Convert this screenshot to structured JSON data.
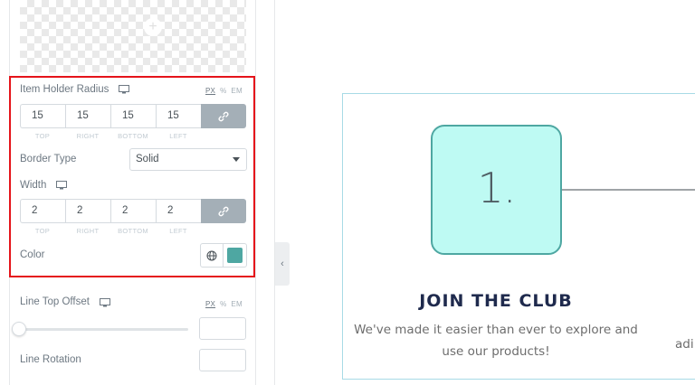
{
  "panel": {
    "item_holder_radius": {
      "label": "Item Holder Radius",
      "units": [
        "PX",
        "%",
        "EM"
      ],
      "active_unit": "PX",
      "values": {
        "top": "15",
        "right": "15",
        "bottom": "15",
        "left": "15"
      },
      "side_labels": {
        "top": "TOP",
        "right": "RIGHT",
        "bottom": "BOTTOM",
        "left": "LEFT"
      }
    },
    "border_type": {
      "label": "Border Type",
      "value": "Solid"
    },
    "width": {
      "label": "Width",
      "values": {
        "top": "2",
        "right": "2",
        "bottom": "2",
        "left": "2"
      },
      "side_labels": {
        "top": "TOP",
        "right": "RIGHT",
        "bottom": "BOTTOM",
        "left": "LEFT"
      }
    },
    "color": {
      "label": "Color",
      "value": "#4ea7a2"
    },
    "line_top_offset": {
      "label": "Line Top Offset",
      "units": [
        "PX",
        "%",
        "EM"
      ],
      "active_unit": "PX",
      "slider_value": 0
    },
    "line_rotation": {
      "label": "Line Rotation"
    },
    "highlight_color": "#e5141a"
  },
  "canvas": {
    "step_number": "1.",
    "step_title": "JOIN THE CLUB",
    "step_desc_line1": "We've made it easier than ever to explore and",
    "step_desc_line2": "use our products!",
    "next_desc_fragment": "adi",
    "step_fill": "#befaf3",
    "step_border": "#4ea7a2",
    "title_color": "#1f2a4d"
  },
  "icons": {
    "monitor": "monitor-icon",
    "link": "link-icon",
    "globe": "globe-icon",
    "collapse": "chevron-left-icon",
    "add_image": "plus-icon"
  }
}
